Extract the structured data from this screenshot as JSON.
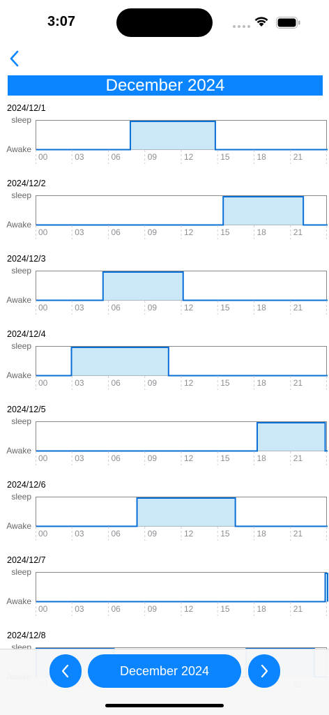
{
  "status_bar": {
    "time": "3:07"
  },
  "header": {
    "month_title": "December 2024"
  },
  "chart_data": {
    "type": "step",
    "y_categories": [
      "Awake",
      "sleep"
    ],
    "x_ticks": [
      "00",
      "03",
      "06",
      "09",
      "12",
      "15",
      "18",
      "21"
    ],
    "x_range_hours": [
      0,
      24
    ],
    "days": [
      {
        "date": "2024/12/1",
        "sleep": [
          [
            7.75,
            14.75
          ]
        ]
      },
      {
        "date": "2024/12/2",
        "sleep": [
          [
            15.4,
            22.0
          ]
        ]
      },
      {
        "date": "2024/12/3",
        "sleep": [
          [
            5.5,
            12.1
          ]
        ]
      },
      {
        "date": "2024/12/4",
        "sleep": [
          [
            2.9,
            10.9
          ]
        ]
      },
      {
        "date": "2024/12/5",
        "sleep": [
          [
            18.2,
            23.8
          ]
        ]
      },
      {
        "date": "2024/12/6",
        "sleep": [
          [
            8.3,
            16.4
          ]
        ]
      },
      {
        "date": "2024/12/7",
        "sleep": [
          [
            23.8,
            24.0
          ]
        ]
      },
      {
        "date": "2024/12/8",
        "sleep": [
          [
            0.0,
            6.4
          ],
          [
            17.3,
            22.9
          ]
        ]
      }
    ],
    "colors": {
      "line": "#0a6fd6",
      "fill": "#cbe8f8",
      "grid": "#cfcfcf"
    }
  },
  "bottom_nav": {
    "month_label": "December 2024"
  }
}
